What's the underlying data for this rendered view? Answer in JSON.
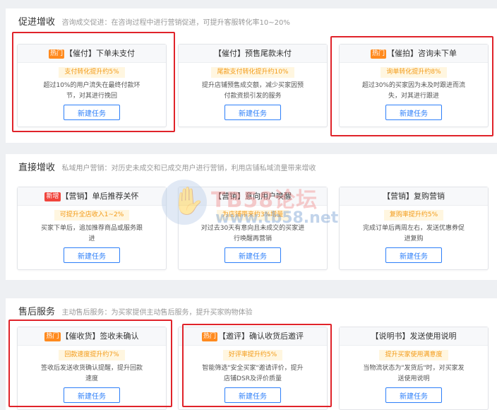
{
  "sections": [
    {
      "title": "促进增收",
      "desc": "咨询成交促进：在咨询过程中进行营销促进，可提升客服转化率10~20%",
      "cards": [
        {
          "tag": "热门",
          "title": "【催付】下单未支付",
          "badge": "支付转化提升约5%",
          "desc": "超过10%的用户流失在最终付款环节，对其进行挽回",
          "button": "新建任务"
        },
        {
          "tag": "",
          "title": "【催付】预售尾款未付",
          "badge": "尾款支付转化提升约10%",
          "desc": "提升店铺预售成交额，减少买家因预付款资损引发的服务",
          "button": "新建任务"
        },
        {
          "tag": "热门",
          "title": "【催拍】咨询未下单",
          "badge": "询单转化提升约8%",
          "desc": "超过30%的买家因为未及时跟进而流失，对其进行跟进",
          "button": "新建任务"
        }
      ]
    },
    {
      "title": "直接增收",
      "desc": "私域用户营销：对历史未成交和已成交用户进行营销，利用店铺私域流量带来增收",
      "cards": [
        {
          "tag": "新增",
          "title": "【营销】单后推荐关怀",
          "badge": "可提升全店收入1~2%",
          "desc": "买家下单后，追加推荐商品或服务跟进",
          "button": "新建任务"
        },
        {
          "tag": "",
          "title": "【营销】意向用户唤醒",
          "badge": "为店铺带来约3%增量",
          "desc": "对过去30天有意向且未成交的买家进行唤醒再营销",
          "button": "新建任务"
        },
        {
          "tag": "",
          "title": "【营销】复购营销",
          "badge": "复购率提升约5%",
          "desc": "完成订单后两周左右，发送优惠券促进复购",
          "button": "新建任务"
        }
      ]
    },
    {
      "title": "售后服务",
      "desc": "主动售后服务：为买家提供主动售后服务，提升买家购物体验",
      "cards": [
        {
          "tag": "热门",
          "title": "【催收货】签收未确认",
          "badge": "回款速度提升约7%",
          "desc": "签收后发送收货确认提醒，提升回款速度",
          "button": "新建任务"
        },
        {
          "tag": "热门",
          "title": "【邀评】确认收货后邀评",
          "badge": "好评率提升约5%",
          "desc": "智能筛选\"安全买家\"邀请评价，提升店铺DSR及评价质量",
          "button": "新建任务"
        },
        {
          "tag": "",
          "title": "【说明书】发送使用说明",
          "badge": "提升买家使用满意度",
          "desc": "当物流状态为\"发货后\"时，对买家发送使用说明",
          "button": "新建任务"
        }
      ]
    }
  ],
  "watermark": {
    "title": "TB58论坛",
    "url": "www.tb58.net"
  },
  "colors": {
    "primary": "#2d7ff9",
    "hot_tag": "#ff8a1e",
    "new_tag": "#f0443c",
    "badge_text": "#f39b17",
    "badge_bg": "#fff6e0",
    "highlight": "#e0232a"
  }
}
